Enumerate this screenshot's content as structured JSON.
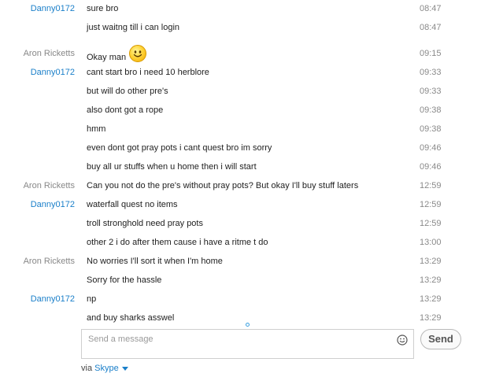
{
  "messages": [
    {
      "sender": "Danny0172",
      "text": "sure bro",
      "time": "08:47"
    },
    {
      "sender": "",
      "text": "just waitng till i can login",
      "time": "08:47"
    },
    {
      "sender": "Aron Ricketts",
      "text": "Okay man",
      "time": "09:15",
      "emoji": "smiley-emoji"
    },
    {
      "sender": "Danny0172",
      "text": "cant start bro i need 10 herblore",
      "time": "09:33"
    },
    {
      "sender": "",
      "text": "but will do other pre's",
      "time": "09:33"
    },
    {
      "sender": "",
      "text": "also dont got a rope",
      "time": "09:38"
    },
    {
      "sender": "",
      "text": "hmm",
      "time": "09:38"
    },
    {
      "sender": "",
      "text": "even dont got pray pots i cant quest bro im sorry",
      "time": "09:46"
    },
    {
      "sender": "",
      "text": "buy all ur stuffs when u home then i will start",
      "time": "09:46"
    },
    {
      "sender": "Aron Ricketts",
      "text": "Can you not do the pre's without pray pots? But okay I'll buy stuff laters",
      "time": "12:59"
    },
    {
      "sender": "Danny0172",
      "text": "waterfall quest no items",
      "time": "12:59"
    },
    {
      "sender": "",
      "text": "troll stronghold need pray pots",
      "time": "12:59"
    },
    {
      "sender": "",
      "text": "other 2 i do after them cause i have a ritme t do",
      "time": "13:00"
    },
    {
      "sender": "Aron Ricketts",
      "text": "No worries I'll sort it when I'm home",
      "time": "13:29"
    },
    {
      "sender": "",
      "text": "Sorry for the hassle",
      "time": "13:29"
    },
    {
      "sender": "Danny0172",
      "text": "np",
      "time": "13:29"
    },
    {
      "sender": "",
      "text": "and buy sharks asswel",
      "time": "13:29"
    }
  ],
  "compose": {
    "placeholder": "Send a message",
    "send_label": "Send",
    "emoji_icon": "smiley-icon"
  },
  "footer": {
    "via_label": "via",
    "service": "Skype",
    "dropdown_icon": "caret-down-icon"
  },
  "colors": {
    "danny": "#1a7fc9",
    "aron": "#888888",
    "link": "#1a7fc9"
  }
}
